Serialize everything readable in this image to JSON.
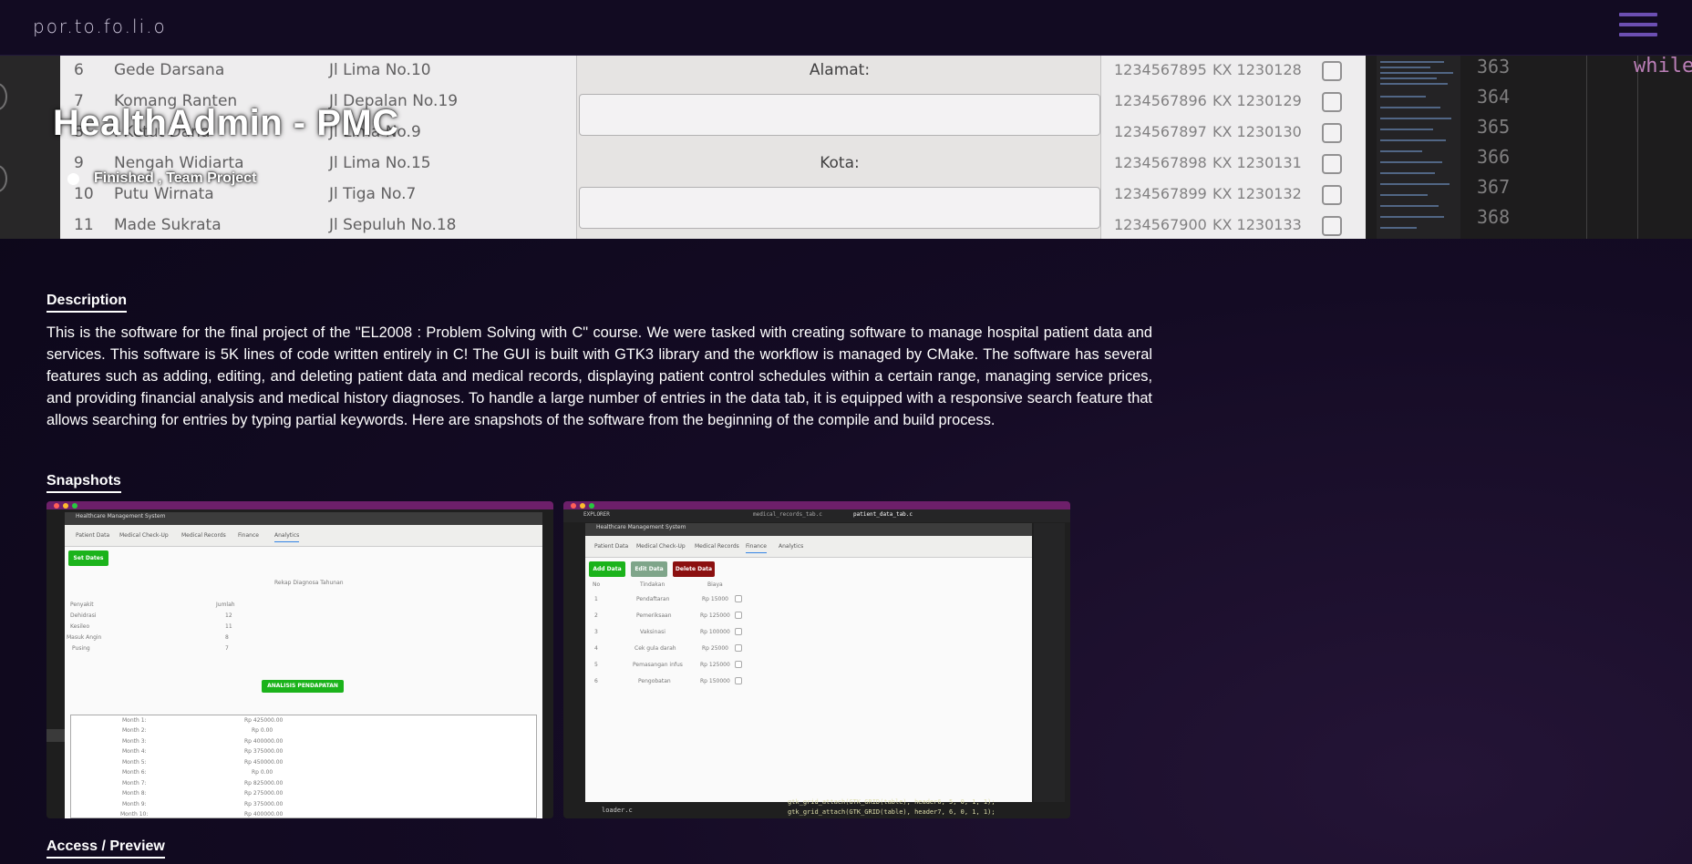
{
  "nav": {
    "brand": "por.to.fo.li.o"
  },
  "hero": {
    "title": "HealthAdmin - PMC",
    "status": "Finished , Team Project",
    "table_rows": [
      {
        "no": "6",
        "name": "Gede Darsana",
        "address": "Jl Lima No.10"
      },
      {
        "no": "7",
        "name": "Komang Ranten",
        "address": "Jl Depalan No.19"
      },
      {
        "no": "8",
        "name": "I Ketut Dana",
        "address": "Jl Lima No.9"
      },
      {
        "no": "9",
        "name": "Nengah Widiarta",
        "address": "Jl Lima No.15"
      },
      {
        "no": "10",
        "name": "Putu Wirnata",
        "address": "Jl Tiga No.7"
      },
      {
        "no": "11",
        "name": "Made Sukrata",
        "address": "Jl Sepuluh No.18"
      }
    ],
    "form_labels": {
      "address": "Alamat:",
      "city": "Kota:"
    },
    "id_rows": [
      {
        "id": "1234567895",
        "kx": "KX 1230128"
      },
      {
        "id": "1234567896",
        "kx": "KX 1230129"
      },
      {
        "id": "1234567897",
        "kx": "KX 1230130"
      },
      {
        "id": "1234567898",
        "kx": "KX 1230131"
      },
      {
        "id": "1234567899",
        "kx": "KX 1230132"
      },
      {
        "id": "1234567900",
        "kx": "KX 1230133"
      }
    ],
    "line_numbers": [
      "363",
      "364",
      "365",
      "366",
      "367",
      "368"
    ],
    "code_keyword": "while"
  },
  "description": {
    "heading": "Description",
    "text": "This is the software for the final project of the \"EL2008 : Problem Solving with C\" course. We were tasked with creating software to manage hospital patient data and services. This software is 5K lines of code written entirely in C! The GUI is built with GTK3 library and the workflow is managed by CMake. The software has several features such as adding, editing, and deleting patient data and medical records, displaying patient control schedules within a certain range, managing service prices, and providing financial analysis and medical history diagnoses. To handle a large number of entries in the data tab, it is equipped with a responsive search feature that allows searching for entries by typing partial keywords. Here are snapshots of the software from the beginning of the compile and build process."
  },
  "snapshots": {
    "heading": "Snapshots",
    "app_title": "Healthcare Management System",
    "tabs": [
      "Patient Data",
      "Medical Check-Up",
      "Medical Records",
      "Finance",
      "Analytics"
    ],
    "shot1": {
      "set_dates": "Set Dates",
      "recap_title": "Rekap Diagnosa Tahunan",
      "col_disease": "Penyakit",
      "col_count": "Jumlah",
      "diagnoses": [
        {
          "name": "Dehidrasi",
          "count": "12"
        },
        {
          "name": "Kesileo",
          "count": "11"
        },
        {
          "name": "Masuk Angin",
          "count": "8"
        },
        {
          "name": "Pusing",
          "count": "7"
        }
      ],
      "analysis_button": "ANALISIS PENDAPATAN",
      "months": [
        {
          "m": "Month 1:",
          "v": "Rp 425000.00"
        },
        {
          "m": "Month 2:",
          "v": "Rp 0.00"
        },
        {
          "m": "Month 3:",
          "v": "Rp 400000.00"
        },
        {
          "m": "Month 4:",
          "v": "Rp 375000.00"
        },
        {
          "m": "Month 5:",
          "v": "Rp 450000.00"
        },
        {
          "m": "Month 6:",
          "v": "Rp 0.00"
        },
        {
          "m": "Month 7:",
          "v": "Rp 825000.00"
        },
        {
          "m": "Month 8:",
          "v": "Rp 275000.00"
        },
        {
          "m": "Month 9:",
          "v": "Rp 375000.00"
        },
        {
          "m": "Month 10:",
          "v": "Rp 400000.00"
        }
      ]
    },
    "shot2": {
      "explorer": "EXPLORER",
      "file_tab1": "medical_records_tab.c",
      "file_tab2": "patient_data_tab.c",
      "add": "Add Data",
      "edit": "Edit Data",
      "delete": "Delete Data",
      "col_no": "No",
      "col_action": "Tindakan",
      "col_cost": "Biaya",
      "rows": [
        {
          "no": "1",
          "action": "Pendaftaran",
          "cost": "Rp 15000"
        },
        {
          "no": "2",
          "action": "Pemeriksaan",
          "cost": "Rp 125000"
        },
        {
          "no": "3",
          "action": "Vaksinasi",
          "cost": "Rp 100000"
        },
        {
          "no": "4",
          "action": "Cek gula darah",
          "cost": "Rp 25000"
        },
        {
          "no": "5",
          "action": "Pemasangan infus",
          "cost": "Rp 125000"
        },
        {
          "no": "6",
          "action": "Pengobatan",
          "cost": "Rp 150000"
        }
      ],
      "loader_file": "loader.c",
      "code_line1": "gtk_grid_attach(GTK_GRID(table), header6, 5, 0, 1, 1);",
      "code_line2": "gtk_grid_attach(GTK_GRID(table), header7, 6, 0, 1, 1);"
    }
  },
  "access": {
    "heading": "Access / Preview"
  },
  "colors": {
    "accent": "#6c4fb3",
    "brand_green": "#1bb31b",
    "delete_red": "#8b1010"
  }
}
